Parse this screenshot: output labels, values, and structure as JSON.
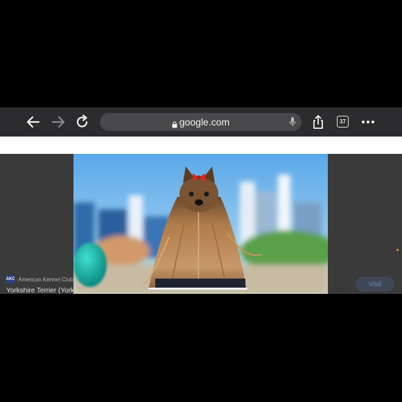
{
  "browser": {
    "url": "google.com",
    "tab_count": "37"
  },
  "result": {
    "source_logo_text": "AKC",
    "source_name": "American Kennel Club",
    "title": "Yorkshire Terrier (Yorkie",
    "visit_label": "Visit"
  },
  "image": {
    "subject": "Yorkshire Terrier with red bow, long silky coat, blurred city background"
  },
  "colors": {
    "toolbar": "#2c2c2e",
    "urlbar": "#48484a",
    "page_bg": "#3a3a3a"
  }
}
